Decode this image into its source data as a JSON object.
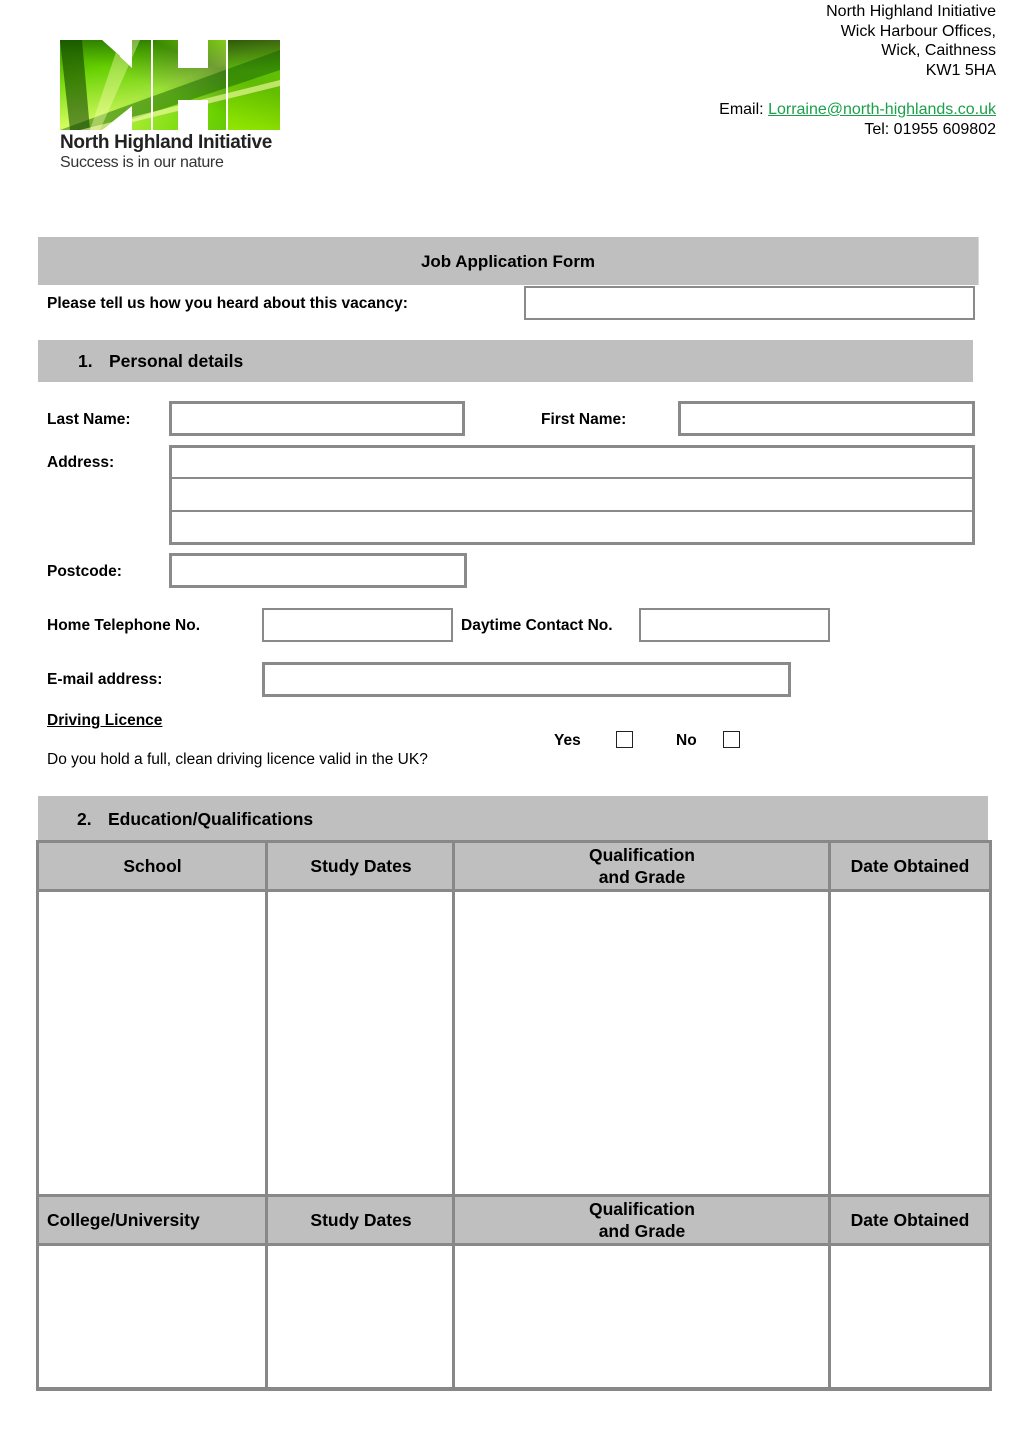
{
  "logo": {
    "monogram": "NHI",
    "name": "North Highland Initiative",
    "tagline": "Success is in our nature",
    "colors": {
      "light": "#f4ff7a",
      "mid": "#7ee000",
      "dark": "#0a3a00"
    }
  },
  "address": {
    "lines": [
      "North Highland Initiative",
      "Wick Harbour Offices,",
      "Wick, Caithness",
      "KW1 5HA"
    ],
    "email_label": "Email: ",
    "email": "Lorraine@north-highlands.co.uk",
    "tel": "Tel: 01955 609802",
    "link_color": "#1aa04a"
  },
  "form": {
    "title": "Job Application Form",
    "vacancy_question": "Please tell us how you heard about this vacancy:",
    "vacancy_value": ""
  },
  "personal": {
    "number": "1.",
    "heading": "Personal details",
    "last_name_label": "Last Name:",
    "last_name": "",
    "first_name_label": "First Name:",
    "first_name": "",
    "address_label": "Address:",
    "address_lines": [
      "",
      "",
      ""
    ],
    "postcode_label": "Postcode:",
    "postcode": "",
    "home_tel_label": "Home Telephone No.",
    "home_tel": "",
    "daytime_label": "Daytime Contact No.",
    "daytime": "",
    "email_label": "E-mail address:",
    "email": "",
    "driving_heading": "Driving Licence",
    "driving_question": "Do you hold a full, clean driving licence valid in the UK?",
    "yes_label": "Yes",
    "yes_checked": false,
    "no_label": "No",
    "no_checked": false
  },
  "education": {
    "number": "2.",
    "heading": "Education/Qualifications",
    "school_headers": [
      "School",
      "Study Dates",
      "Qualification\nand Grade",
      "Date Obtained"
    ],
    "college_headers": [
      "College/University",
      "Study Dates",
      "Qualification\nand Grade",
      "Date Obtained"
    ],
    "school_rows": [
      [
        "",
        "",
        "",
        ""
      ]
    ],
    "college_rows": [
      [
        "",
        "",
        "",
        ""
      ]
    ]
  },
  "colors": {
    "bar_grey": "#bfbfbf",
    "border_grey": "#888888"
  }
}
